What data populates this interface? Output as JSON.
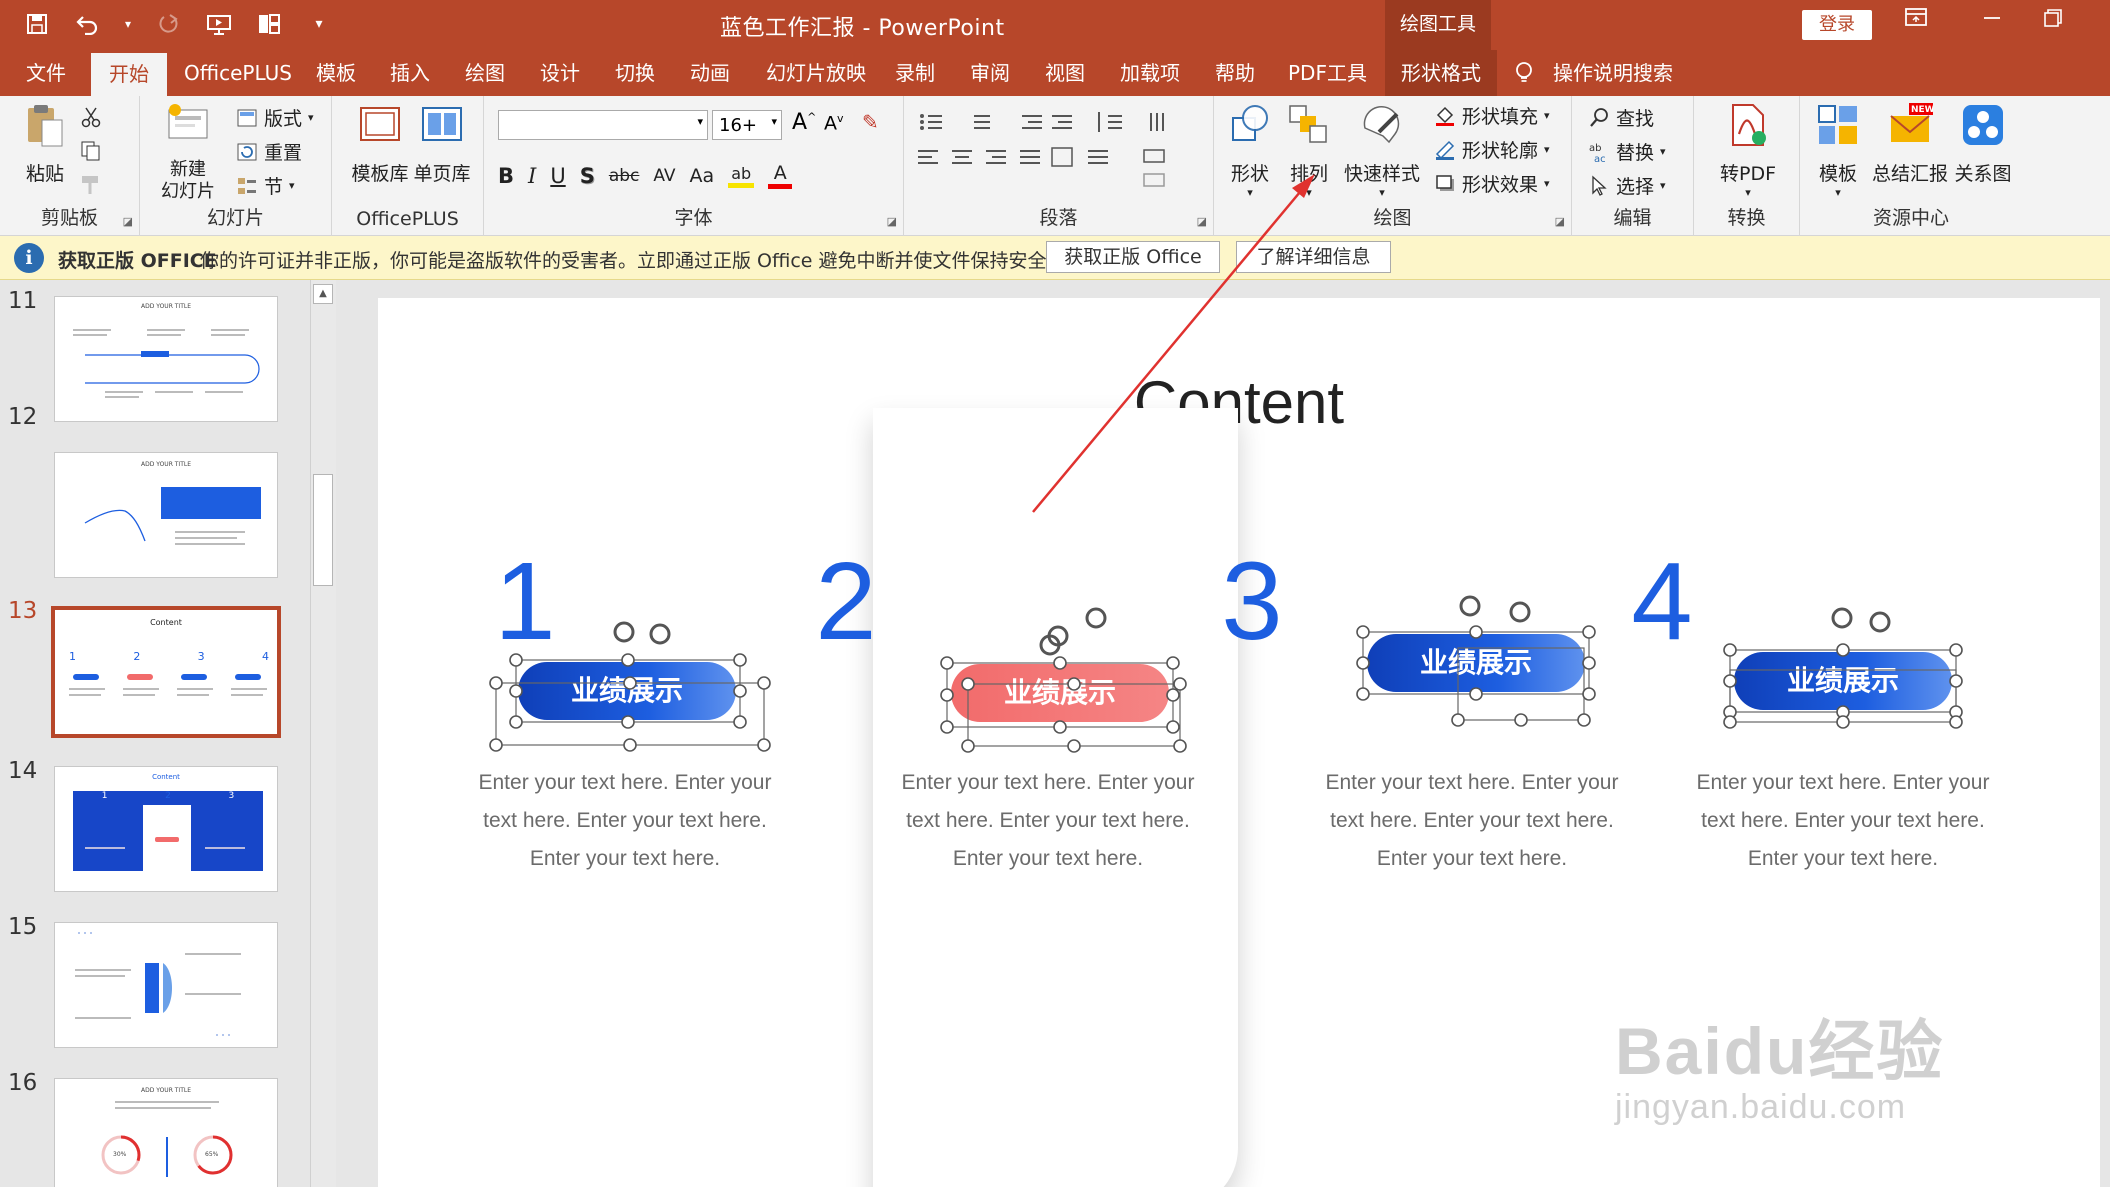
{
  "window": {
    "title": "蓝色工作汇报 - PowerPoint",
    "contextual_tab_group": "绘图工具",
    "login": "登录"
  },
  "tabs": [
    "文件",
    "开始",
    "OfficePLUS",
    "模板",
    "插入",
    "绘图",
    "设计",
    "切换",
    "动画",
    "幻灯片放映",
    "录制",
    "审阅",
    "视图",
    "加载项",
    "帮助",
    "PDF工具",
    "形状格式"
  ],
  "active_tab": "开始",
  "tell_me": "操作说明搜索",
  "ribbon": {
    "clipboard": {
      "label": "剪贴板",
      "paste": "粘贴"
    },
    "slides": {
      "label": "幻灯片",
      "new_slide_1": "新建",
      "new_slide_2": "幻灯片",
      "layout": "版式",
      "reset": "重置",
      "section": "节"
    },
    "officeplus": {
      "label": "OfficePLUS",
      "template_lib": "模板库",
      "single_page_lib": "单页库"
    },
    "font": {
      "label": "字体",
      "name_value": "",
      "size_value": "16+",
      "bold": "B",
      "italic": "I",
      "underline": "U",
      "shadow": "S",
      "strike": "abc",
      "spacing": "AV",
      "case": "Aa"
    },
    "paragraph": {
      "label": "段落"
    },
    "drawing": {
      "label": "绘图",
      "shapes": "形状",
      "arrange": "排列",
      "quick_styles": "快速样式",
      "fill": "形状填充",
      "outline": "形状轮廓",
      "effects": "形状效果"
    },
    "editing": {
      "label": "编辑",
      "find": "查找",
      "replace": "替换",
      "select": "选择"
    },
    "convert": {
      "label": "转换",
      "to_pdf": "转PDF"
    },
    "resources": {
      "label": "资源中心",
      "templates": "模板",
      "summary": "总结汇报",
      "relation": "关系图",
      "new_badge": "NEW"
    }
  },
  "message_bar": {
    "title": "获取正版 OFFICE",
    "text": "你的许可证并非正版，你可能是盗版软件的受害者。立即通过正版 Office 避免中断并使文件保持安全。",
    "btn_get": "获取正版 Office",
    "btn_more": "了解详细信息"
  },
  "thumbnails": [
    {
      "num": "11",
      "title": "ADD YOUR TITLE"
    },
    {
      "num": "12",
      "title": "ADD YOUR TITLE"
    },
    {
      "num": "13",
      "title": "Content",
      "active": true
    },
    {
      "num": "14",
      "title": "Content"
    },
    {
      "num": "15",
      "title": ""
    },
    {
      "num": "16",
      "title": "ADD YOUR TITLE"
    }
  ],
  "thumb_labels": {
    "pct_30": "30%",
    "pct_65": "65%",
    "n1": "1",
    "n2": "2",
    "n3": "3",
    "n4": "4"
  },
  "slide": {
    "title": "Content",
    "items": [
      {
        "number": "1",
        "badge": "业绩展示",
        "text1": "Enter your text here. Enter your",
        "text2": "text here. Enter your text here.",
        "text3": "Enter your text here."
      },
      {
        "number": "2",
        "badge": "业绩展示",
        "text1": "Enter your text here. Enter your",
        "text2": "text here. Enter your text here.",
        "text3": "Enter your text here."
      },
      {
        "number": "3",
        "badge": "业绩展示",
        "text1": "Enter your text here. Enter your",
        "text2": "text here. Enter your text here.",
        "text3": "Enter your text here."
      },
      {
        "number": "4",
        "badge": "业绩展示",
        "text1": "Enter your text here. Enter your",
        "text2": "text here. Enter your text here.",
        "text3": "Enter your text here."
      }
    ]
  },
  "watermark": {
    "brand": "Baidu经验",
    "url": "jingyan.baidu.com"
  },
  "colors": {
    "accent": "#b7472a",
    "blue": "#1746c8",
    "red": "#f26b6b",
    "annotation": "#e0322f"
  }
}
